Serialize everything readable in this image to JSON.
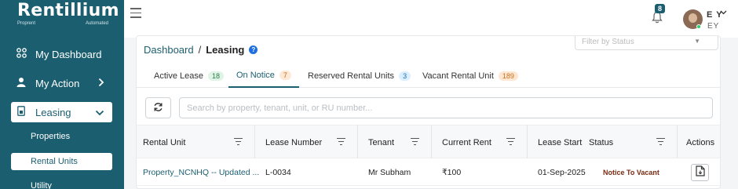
{
  "brand": {
    "name": "Rentillium",
    "tagline_left": "Proprent",
    "tagline_right": "Automated",
    "accent": "#1b5e70"
  },
  "sidebar": {
    "items": [
      {
        "label": "My Dashboard",
        "icon": "dashboard-icon"
      },
      {
        "label": "My Action",
        "icon": "person-icon",
        "chevron": ">"
      },
      {
        "label": "Leasing",
        "icon": "lease-icon",
        "chevron": "v",
        "active": true
      }
    ],
    "subitems": [
      {
        "label": "Properties"
      },
      {
        "label": "Rental Units",
        "active": true
      },
      {
        "label": "Utility"
      }
    ]
  },
  "topbar": {
    "notification_count": "8",
    "user_initials": "E Y",
    "user_sub": "EY"
  },
  "breadcrumb": {
    "root": "Dashboard",
    "sep": "/",
    "current": "Leasing",
    "info": "?"
  },
  "status_filter": {
    "placeholder": "Filter by Status"
  },
  "tabs": [
    {
      "label": "Active Lease",
      "count": "18"
    },
    {
      "label": "On Notice",
      "count": "7",
      "active": true
    },
    {
      "label": "Reserved Rental Units",
      "count": "3"
    },
    {
      "label": "Vacant Rental Unit",
      "count": "189"
    }
  ],
  "search": {
    "placeholder": "Search by property, tenant, unit, or RU number..."
  },
  "table": {
    "columns": [
      "Rental Unit",
      "Lease Number",
      "Tenant",
      "Current Rent",
      "Lease Start",
      "Status",
      "Actions"
    ],
    "rows": [
      {
        "rental_unit": "Property_NCNHQ -- Updated ...",
        "lease_number": "L-0034",
        "tenant": "Mr Subham",
        "current_rent": "₹100",
        "lease_start": "01-Sep-2025",
        "status": "Notice To Vacant"
      }
    ]
  }
}
